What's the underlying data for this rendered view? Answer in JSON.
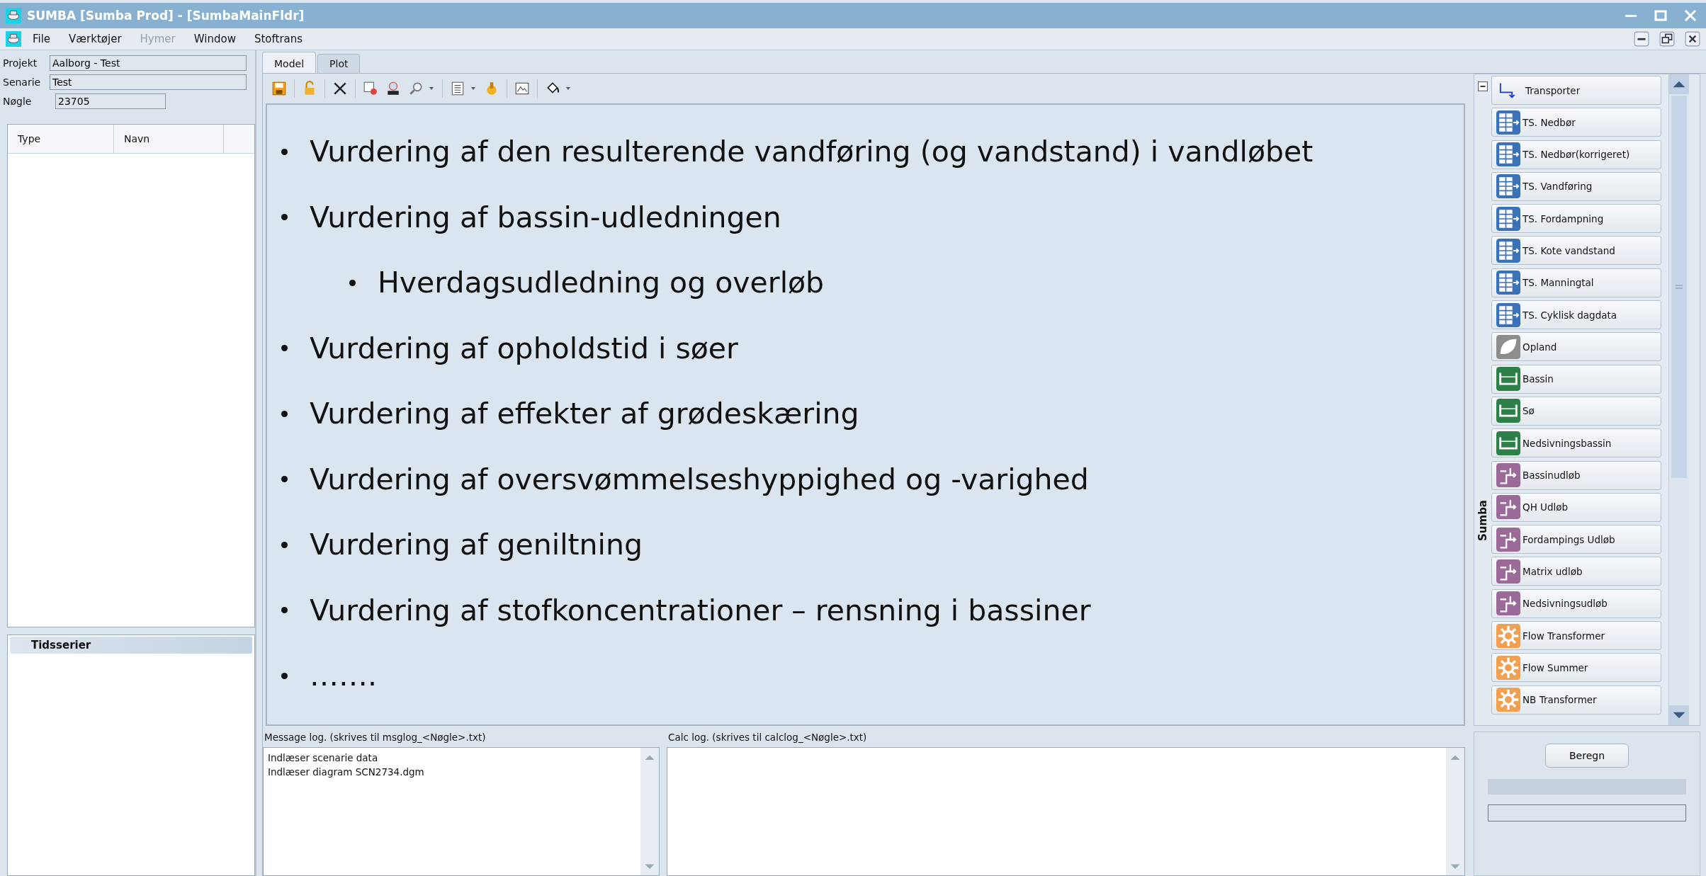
{
  "window": {
    "title": "SUMBA [Sumba Prod] - [SumbaMainFldr]"
  },
  "menu": [
    {
      "label": "File",
      "disabled": false
    },
    {
      "label": "Værktøjer",
      "disabled": false
    },
    {
      "label": "Hymer",
      "disabled": true
    },
    {
      "label": "Window",
      "disabled": false
    },
    {
      "label": "Stoftrans",
      "disabled": false
    }
  ],
  "project_fields": [
    {
      "label": "Projekt",
      "value": "Aalborg - Test"
    },
    {
      "label": "Senarie",
      "value": "Test"
    },
    {
      "label": "Nøgle",
      "value": "23705"
    }
  ],
  "element_table": {
    "columns": [
      "Type",
      "Navn"
    ]
  },
  "timeseries_panel": {
    "title": "Tidsserier"
  },
  "tabs": [
    {
      "label": "Model",
      "selected": true
    },
    {
      "label": "Plot",
      "selected": false
    }
  ],
  "canvas_bullets": [
    {
      "text": "Vurdering af den resulterende vandføring (og vandstand) i vandløbet"
    },
    {
      "text": "Vurdering af bassin-udledningen",
      "children": [
        {
          "text": "Hverdagsudledning og overløb"
        }
      ]
    },
    {
      "text": "Vurdering af opholdstid i søer"
    },
    {
      "text": "Vurdering af effekter af grødeskæring"
    },
    {
      "text": "Vurdering af oversvømmelseshyppighed og -varighed"
    },
    {
      "text": "Vurdering af geniltning"
    },
    {
      "text": "Vurdering af stofkoncentrationer – rensning i bassiner"
    },
    {
      "text": "……."
    }
  ],
  "palette": {
    "group": "Sumba",
    "items": [
      {
        "label": "Transporter",
        "kind": "transporter"
      },
      {
        "label": "TS. Nedbør",
        "kind": "timeseries"
      },
      {
        "label": "TS. Nedbør(korrigeret)",
        "kind": "timeseries"
      },
      {
        "label": "TS. Vandføring",
        "kind": "timeseries"
      },
      {
        "label": "TS. Fordampning",
        "kind": "timeseries"
      },
      {
        "label": "TS. Kote vandstand",
        "kind": "timeseries"
      },
      {
        "label": "TS. Manningtal",
        "kind": "timeseries"
      },
      {
        "label": "TS. Cyklisk dagdata",
        "kind": "timeseries"
      },
      {
        "label": "Opland",
        "kind": "catchment"
      },
      {
        "label": "Bassin",
        "kind": "basin"
      },
      {
        "label": "Sø",
        "kind": "basin"
      },
      {
        "label": "Nedsivningsbassin",
        "kind": "basin"
      },
      {
        "label": "Bassinudløb",
        "kind": "outlet"
      },
      {
        "label": "QH Udløb",
        "kind": "outlet"
      },
      {
        "label": "Fordampings Udløb",
        "kind": "outlet"
      },
      {
        "label": "Matrix udløb",
        "kind": "outlet"
      },
      {
        "label": "Nedsivningsudløb",
        "kind": "outlet"
      },
      {
        "label": "Flow Transformer",
        "kind": "transformer"
      },
      {
        "label": "Flow Summer",
        "kind": "transformer"
      },
      {
        "label": "NB Transformer",
        "kind": "transformer"
      }
    ]
  },
  "message_log": {
    "title": "Message log. (skrives til msglog_<Nøgle>.txt)",
    "lines": [
      "Indlæser scenarie data",
      "Indlæser diagram SCN2734.dgm"
    ]
  },
  "calc_log": {
    "title": "Calc log. (skrives til calclog_<Nøgle>.txt)"
  },
  "run_button": {
    "label": "Beregn"
  },
  "progress_bar": {
    "level": 0
  }
}
